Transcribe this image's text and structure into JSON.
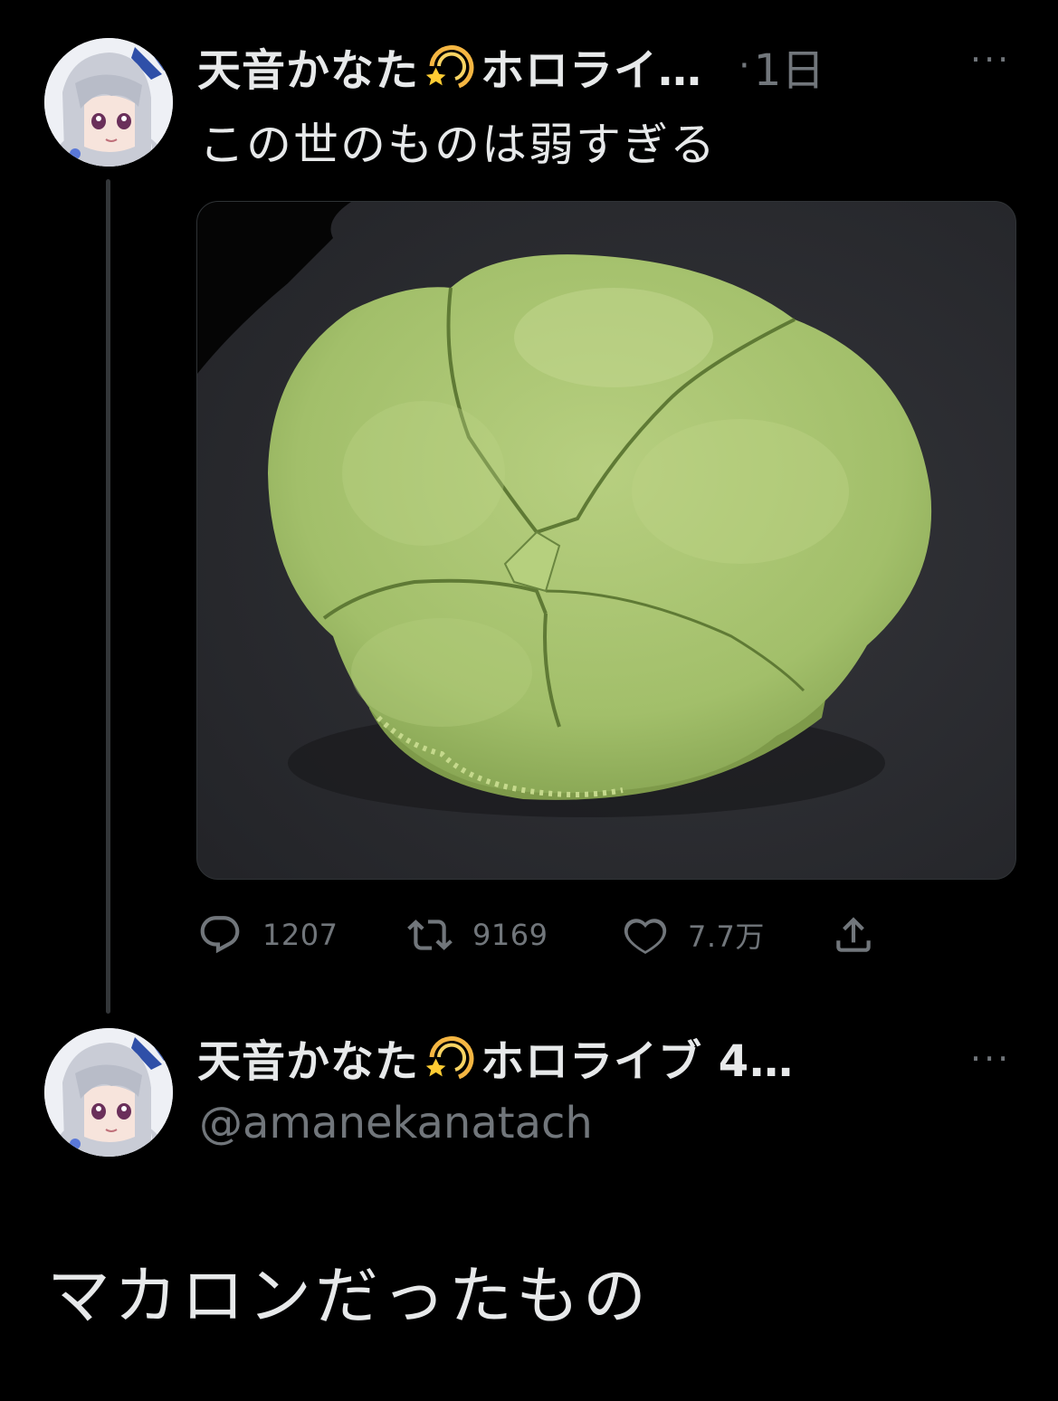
{
  "thread": {
    "parent_tweet": {
      "display_name": "天音かなた",
      "name_suffix": "ホロライ…",
      "name_emoji": "dizzy-emoji",
      "separator": "·",
      "time": "1日",
      "more_label": "···",
      "text": "この世のものは弱すぎる",
      "media": {
        "description_icon": "photo"
      },
      "actions": {
        "reply_count": "1207",
        "retweet_count": "9169",
        "like_count": "7.7万"
      }
    },
    "reply_tweet": {
      "display_name": "天音かなた",
      "name_suffix": "ホロライブ 4…",
      "name_emoji": "dizzy-emoji",
      "handle": "@amanekanatach",
      "more_label": "···",
      "text": "マカロンだったもの"
    }
  },
  "colors": {
    "background": "#000000",
    "primary_text": "#e7e9ea",
    "secondary_text": "#71767b",
    "thread_line": "#333639",
    "macaron_green": "#a9c46e"
  }
}
